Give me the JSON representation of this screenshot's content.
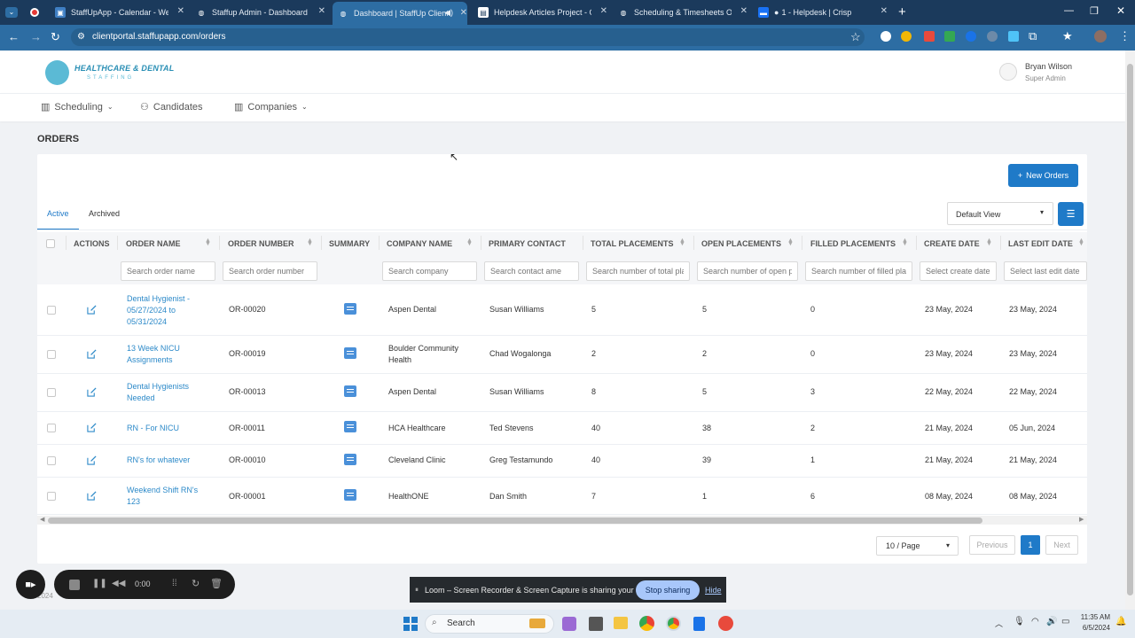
{
  "browser": {
    "tabs": [
      {
        "title": "StaffUpApp - Calendar - Week"
      },
      {
        "title": "Staffup Admin - Dashboard"
      },
      {
        "title": "Dashboard | StaffUp Client"
      },
      {
        "title": "Helpdesk Articles Project - Goo"
      },
      {
        "title": "Scheduling & Timesheets Over"
      },
      {
        "title": "1 - Helpdesk | Crisp"
      }
    ],
    "url": "clientportal.staffupapp.com/orders"
  },
  "header": {
    "logo_line1": "HEALTHCARE & DENTAL",
    "logo_line2": "STAFFING",
    "user_name": "Bryan Wilson",
    "user_role": "Super Admin"
  },
  "nav": {
    "scheduling": "Scheduling",
    "candidates": "Candidates",
    "companies": "Companies"
  },
  "page": {
    "title": "ORDERS",
    "new_orders_label": "New Orders",
    "tab_active": "Active",
    "tab_archived": "Archived",
    "view_select": "Default View"
  },
  "table": {
    "columns": [
      "ACTIONS",
      "ORDER NAME",
      "ORDER NUMBER",
      "SUMMARY",
      "COMPANY NAME",
      "PRIMARY CONTACT",
      "TOTAL PLACEMENTS",
      "OPEN PLACEMENTS",
      "FILLED PLACEMENTS",
      "CREATE DATE",
      "LAST EDIT DATE"
    ],
    "filters": {
      "order_name": "Search order name",
      "order_number": "Search order number",
      "company": "Search company",
      "contact": "Search contact ame",
      "total": "Search number of total pla",
      "open": "Search number of open p",
      "filled": "Search number of filled pla",
      "create": "Select create date",
      "edit": "Select last edit date"
    },
    "rows": [
      {
        "name": "Dental Hygienist - 05/27/2024 to 05/31/2024",
        "number": "OR-00020",
        "company": "Aspen Dental",
        "contact": "Susan Williams",
        "total": "5",
        "open": "5",
        "filled": "0",
        "created": "23 May, 2024",
        "edited": "23 May, 2024"
      },
      {
        "name": "13 Week NICU Assignments",
        "number": "OR-00019",
        "company": "Boulder Community Health",
        "contact": "Chad Wogalonga",
        "total": "2",
        "open": "2",
        "filled": "0",
        "created": "23 May, 2024",
        "edited": "23 May, 2024"
      },
      {
        "name": "Dental Hygienists Needed",
        "number": "OR-00013",
        "company": "Aspen Dental",
        "contact": "Susan Williams",
        "total": "8",
        "open": "5",
        "filled": "3",
        "created": "22 May, 2024",
        "edited": "22 May, 2024"
      },
      {
        "name": "RN - For NICU",
        "number": "OR-00011",
        "company": "HCA Healthcare",
        "contact": "Ted Stevens",
        "total": "40",
        "open": "38",
        "filled": "2",
        "created": "21 May, 2024",
        "edited": "05 Jun, 2024"
      },
      {
        "name": "RN's for whatever",
        "number": "OR-00010",
        "company": "Cleveland Clinic",
        "contact": "Greg Testamundo",
        "total": "40",
        "open": "39",
        "filled": "1",
        "created": "21 May, 2024",
        "edited": "21 May, 2024"
      },
      {
        "name": "Weekend Shift RN's 123",
        "number": "OR-00001",
        "company": "HealthONE",
        "contact": "Dan Smith",
        "total": "7",
        "open": "1",
        "filled": "6",
        "created": "08 May, 2024",
        "edited": "08 May, 2024"
      }
    ]
  },
  "pagination": {
    "page_size": "10 / Page",
    "previous": "Previous",
    "current": "1",
    "next": "Next"
  },
  "loom": {
    "timer": "0:00",
    "share_text": "Loom – Screen Recorder & Screen Capture is sharing your screen.",
    "stop_label": "Stop sharing",
    "hide_label": "Hide"
  },
  "footer": {
    "year_fragment": "2024"
  },
  "taskbar": {
    "search": "Search",
    "time": "11:35 AM",
    "date": "6/5/2024"
  }
}
